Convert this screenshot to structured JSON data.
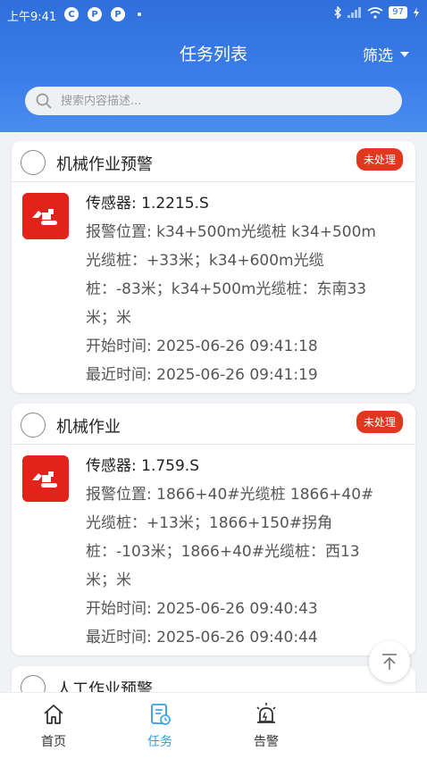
{
  "status_bar": {
    "time": "上午9:41",
    "app_icons": [
      "C",
      "P",
      "P"
    ],
    "battery": "97"
  },
  "header": {
    "title": "任务列表",
    "filter_label": "筛选"
  },
  "search": {
    "placeholder": "搜索内容描述..."
  },
  "cards": [
    {
      "title": "机械作业预警",
      "badge": "未处理",
      "sensor": "传感器: 1.2215.S",
      "location_lines": [
        "报警位置: k34+500m光缆桩 k34+500m",
        "光缆桩：+33米；k34+600m光缆",
        "桩：-83米；k34+500m光缆桩：东南33",
        "米；米"
      ],
      "start_time": "开始时间: 2025-06-26 09:41:18",
      "recent_time": "最近时间: 2025-06-26 09:41:19"
    },
    {
      "title": "机械作业",
      "badge": "未处理",
      "sensor": "传感器: 1.759.S",
      "location_lines": [
        "报警位置: 1866+40#光缆桩 1866+40#",
        "光缆桩：+13米；1866+150#拐角",
        "桩：-103米；1866+40#光缆桩：西13",
        "米；米"
      ],
      "start_time": "开始时间: 2025-06-26 09:40:43",
      "recent_time": "最近时间: 2025-06-26 09:40:44"
    },
    {
      "title": "人工作业预警"
    }
  ],
  "nav": {
    "items": [
      {
        "label": "首页",
        "icon": "home-icon"
      },
      {
        "label": "任务",
        "icon": "task-list-icon",
        "active": true
      },
      {
        "label": "告警",
        "icon": "alarm-icon"
      }
    ]
  },
  "colors": {
    "header": "#2f6fdc",
    "badge": "#e2371f",
    "active_nav": "#2ea1e6",
    "icon_bg": "#e2231a"
  }
}
